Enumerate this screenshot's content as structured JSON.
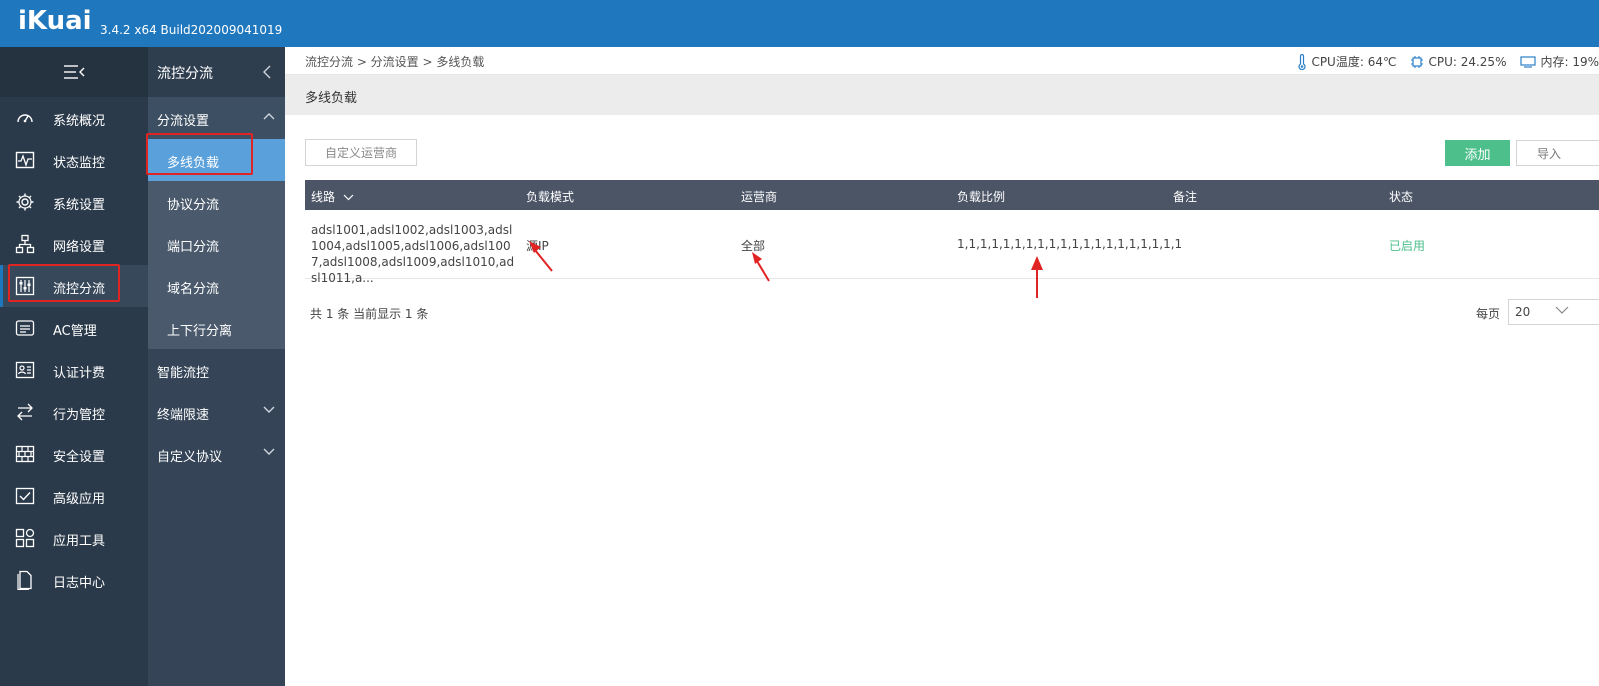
{
  "app": {
    "logo": "iKuai",
    "version": "3.4.2 x64 Build202009041019"
  },
  "sidebar": {
    "items": [
      {
        "label": "系统概况",
        "icon": "dashboard-icon"
      },
      {
        "label": "状态监控",
        "icon": "monitor-icon"
      },
      {
        "label": "系统设置",
        "icon": "gear-icon"
      },
      {
        "label": "网络设置",
        "icon": "network-icon"
      },
      {
        "label": "流控分流",
        "icon": "sliders-icon"
      },
      {
        "label": "AC管理",
        "icon": "router-icon"
      },
      {
        "label": "认证计费",
        "icon": "id-card-icon"
      },
      {
        "label": "行为管控",
        "icon": "swap-icon"
      },
      {
        "label": "安全设置",
        "icon": "firewall-icon"
      },
      {
        "label": "高级应用",
        "icon": "checklist-icon"
      },
      {
        "label": "应用工具",
        "icon": "tools-icon"
      },
      {
        "label": "日志中心",
        "icon": "document-icon"
      }
    ]
  },
  "submenu": {
    "title": "流控分流",
    "group": "分流设置",
    "children": [
      "多线负载",
      "协议分流",
      "端口分流",
      "域名分流",
      "上下行分离"
    ],
    "plain": [
      "智能流控",
      "终端限速",
      "自定义协议"
    ]
  },
  "header": {
    "breadcrumb": "流控分流 > 分流设置 > 多线负载",
    "cpu_temp": "CPU温度: 64℃",
    "cpu": "CPU: 24.25%",
    "mem": "内存: 19%"
  },
  "page": {
    "title": "多线负载",
    "custom_isp_button": "自定义运营商",
    "add_button": "添加",
    "import_button": "导入"
  },
  "table": {
    "columns": [
      "线路",
      "负载模式",
      "运营商",
      "负载比例",
      "备注",
      "状态"
    ],
    "rows": [
      {
        "lines": "adsl1001,adsl1002,adsl1003,adsl1004,adsl1005,adsl1006,adsl1007,adsl1008,adsl1009,adsl1010,adsl1011,a...",
        "mode": "源IP",
        "isp": "全部",
        "ratio": "1,1,1,1,1,1,1,1,1,1,1,1,1,1,1,1,1,1,1,1",
        "remark": "",
        "status": "已启用"
      }
    ]
  },
  "footer": {
    "summary": "共 1 条 当前显示 1 条",
    "per_page_label": "每页",
    "per_page_value": "20"
  },
  "colors": {
    "topbar": "#1f77be",
    "sidebar": "#2b3a4a",
    "active_sub": "#5aa0db",
    "accent_green": "#4cbf8b",
    "annotation_red": "#e02424"
  }
}
